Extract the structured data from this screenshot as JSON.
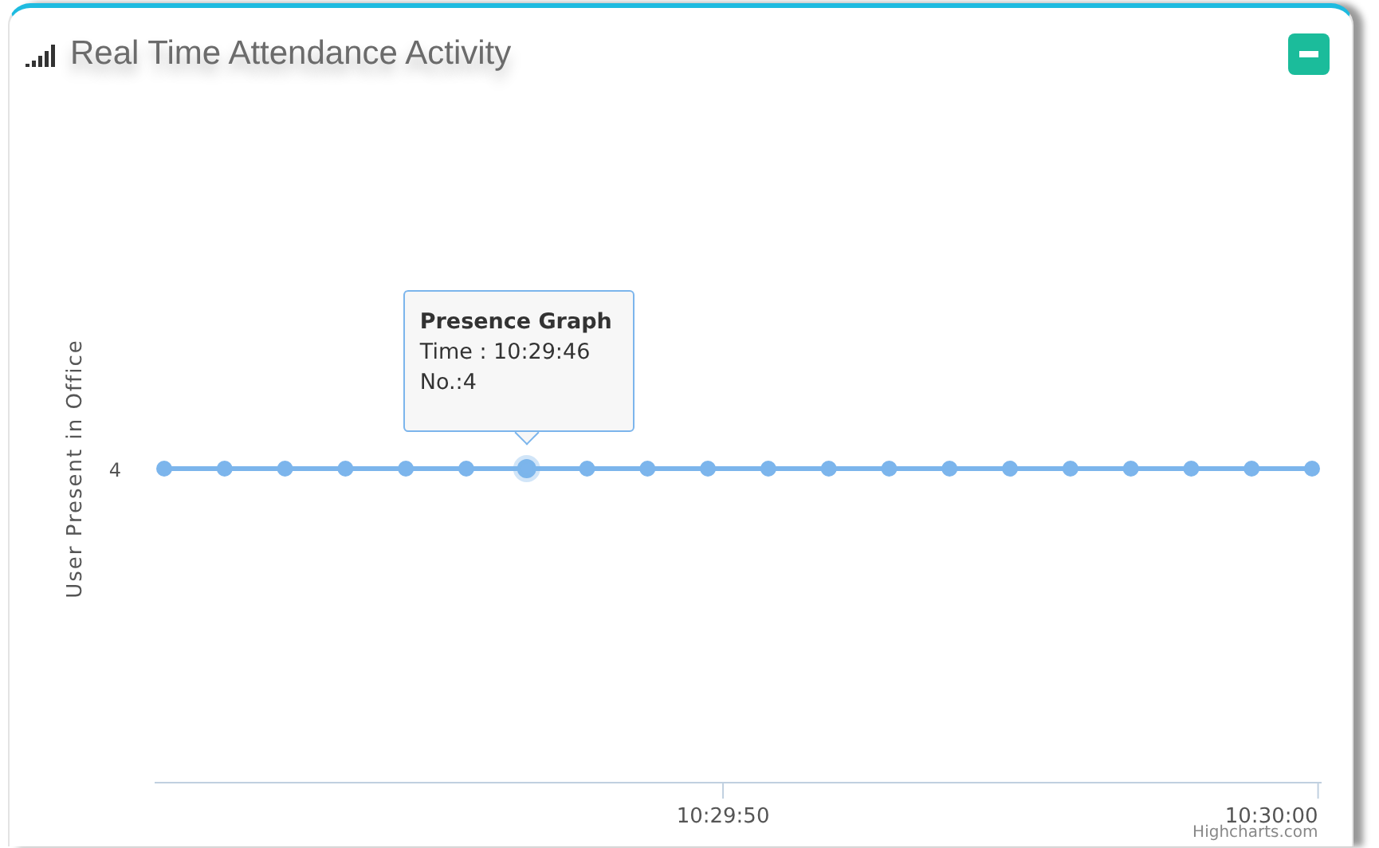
{
  "panel": {
    "title": "Real Time Attendance Activity"
  },
  "chart": {
    "y_title": "User Present in Office",
    "y_tick": "4",
    "x_ticks": [
      "10:29:50",
      "10:30:00"
    ],
    "points": [
      {
        "hovered": false
      },
      {
        "hovered": false
      },
      {
        "hovered": false
      },
      {
        "hovered": false
      },
      {
        "hovered": false
      },
      {
        "hovered": false
      },
      {
        "hovered": true
      },
      {
        "hovered": false
      },
      {
        "hovered": false
      },
      {
        "hovered": false
      },
      {
        "hovered": false
      },
      {
        "hovered": false
      },
      {
        "hovered": false
      },
      {
        "hovered": false
      },
      {
        "hovered": false
      },
      {
        "hovered": false
      },
      {
        "hovered": false
      },
      {
        "hovered": false
      },
      {
        "hovered": false
      },
      {
        "hovered": false
      }
    ]
  },
  "tooltip": {
    "title": "Presence Graph",
    "lines": [
      "Time : 10:29:46",
      "No.:4"
    ]
  },
  "credits": "Highcharts.com"
}
